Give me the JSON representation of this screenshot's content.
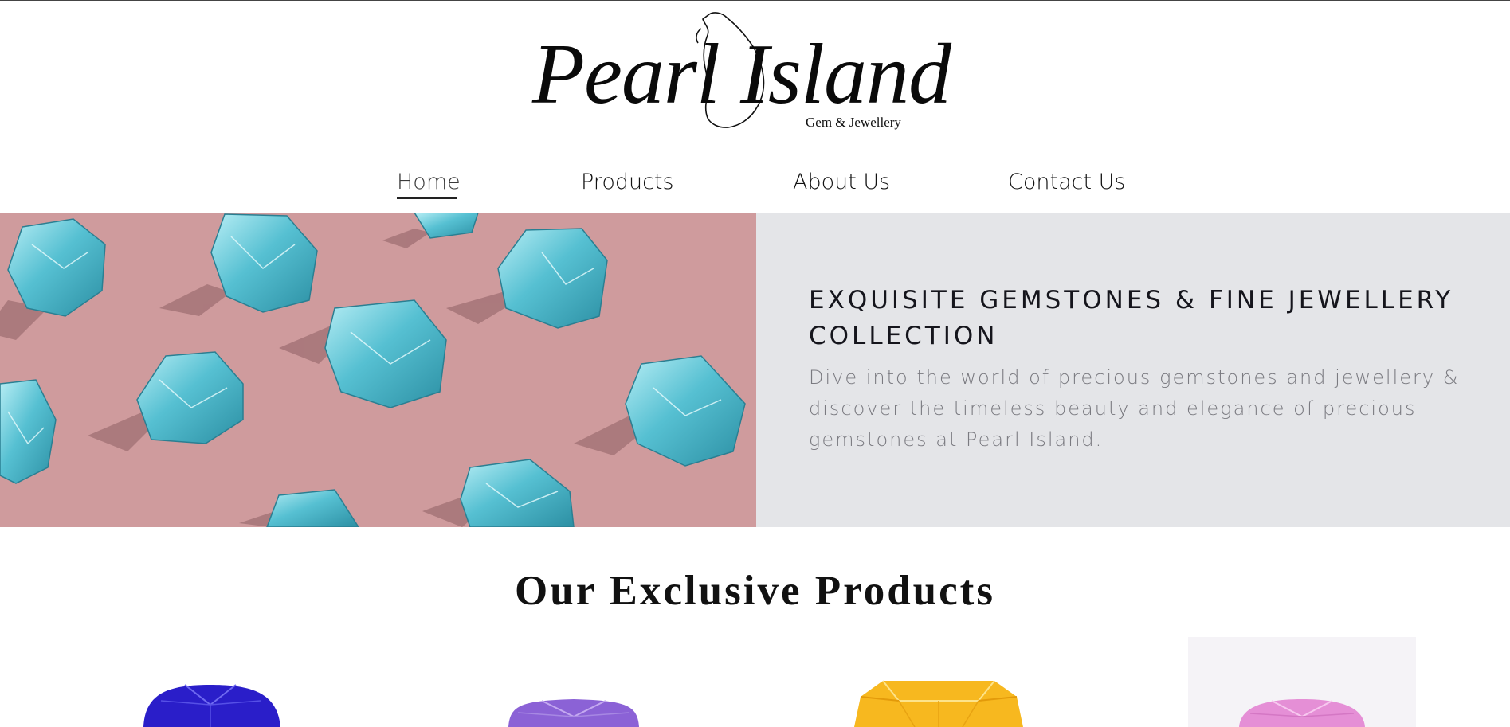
{
  "brand": {
    "name": "Pearl Island",
    "tagline": "Gem & Jewellery"
  },
  "nav": {
    "items": [
      {
        "label": "Home",
        "active": true
      },
      {
        "label": "Products",
        "active": false
      },
      {
        "label": "About Us",
        "active": false
      },
      {
        "label": "Contact Us",
        "active": false
      }
    ]
  },
  "hero": {
    "image": "pink-background-with-aquamarine-crystals",
    "title": "EXQUISITE GEMSTONES & FINE JEWELLERY COLLECTION",
    "text": "Dive into the world of precious gemstones and jewellery & discover the timeless beauty and elegance of precious gemstones at Pearl Island."
  },
  "products": {
    "title": "Our Exclusive Products",
    "items": [
      {
        "image": "blue-sapphire-gem",
        "color": "#2a1ec9"
      },
      {
        "image": "purple-amethyst-gem",
        "color": "#8b62d6"
      },
      {
        "image": "yellow-sapphire-gem",
        "color": "#f7b81f"
      },
      {
        "image": "pink-sapphire-gem",
        "color": "#e58fd6"
      }
    ]
  },
  "colors": {
    "hero_panel": "#e4e5e8",
    "hero_image_bg": "#cf9b9d",
    "crystal": "#5fc4d3"
  }
}
